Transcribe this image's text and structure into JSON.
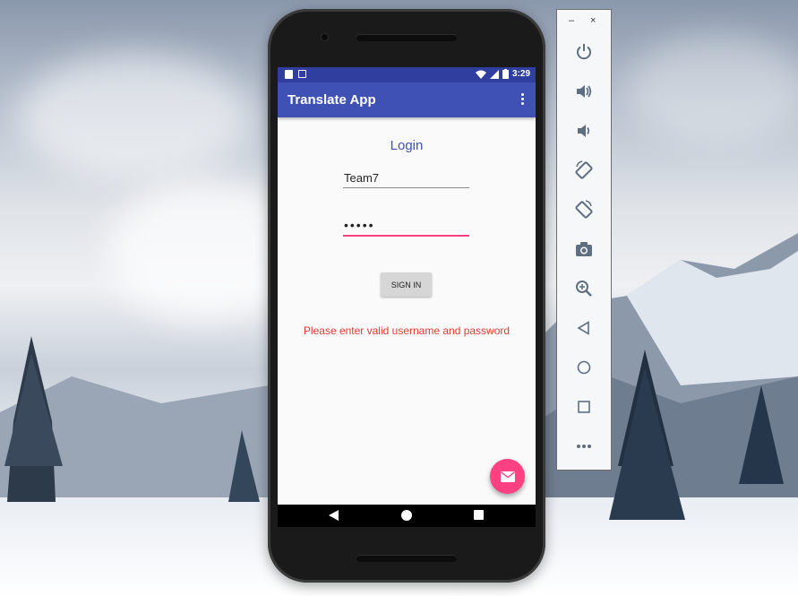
{
  "emulator": {
    "window_controls": {
      "minimize": "–",
      "close": "×"
    },
    "tools": [
      {
        "name": "power-icon"
      },
      {
        "name": "volume-up-icon"
      },
      {
        "name": "volume-down-icon"
      },
      {
        "name": "rotate-left-icon"
      },
      {
        "name": "rotate-right-icon"
      },
      {
        "name": "camera-icon"
      },
      {
        "name": "zoom-icon"
      },
      {
        "name": "back-icon"
      },
      {
        "name": "home-icon"
      },
      {
        "name": "overview-icon"
      },
      {
        "name": "more-icon"
      }
    ]
  },
  "device": {
    "status_bar": {
      "time": "3:29"
    },
    "app_bar": {
      "title": "Translate App"
    },
    "login": {
      "heading": "Login",
      "username_value": "Team7",
      "password_value": "•••••",
      "signin_label": "SIGN IN",
      "error_message": "Please enter valid username and password"
    }
  },
  "colors": {
    "primary": "#3f51b5",
    "primary_dark": "#303f9f",
    "accent": "#ff4081",
    "error": "#e53935"
  }
}
